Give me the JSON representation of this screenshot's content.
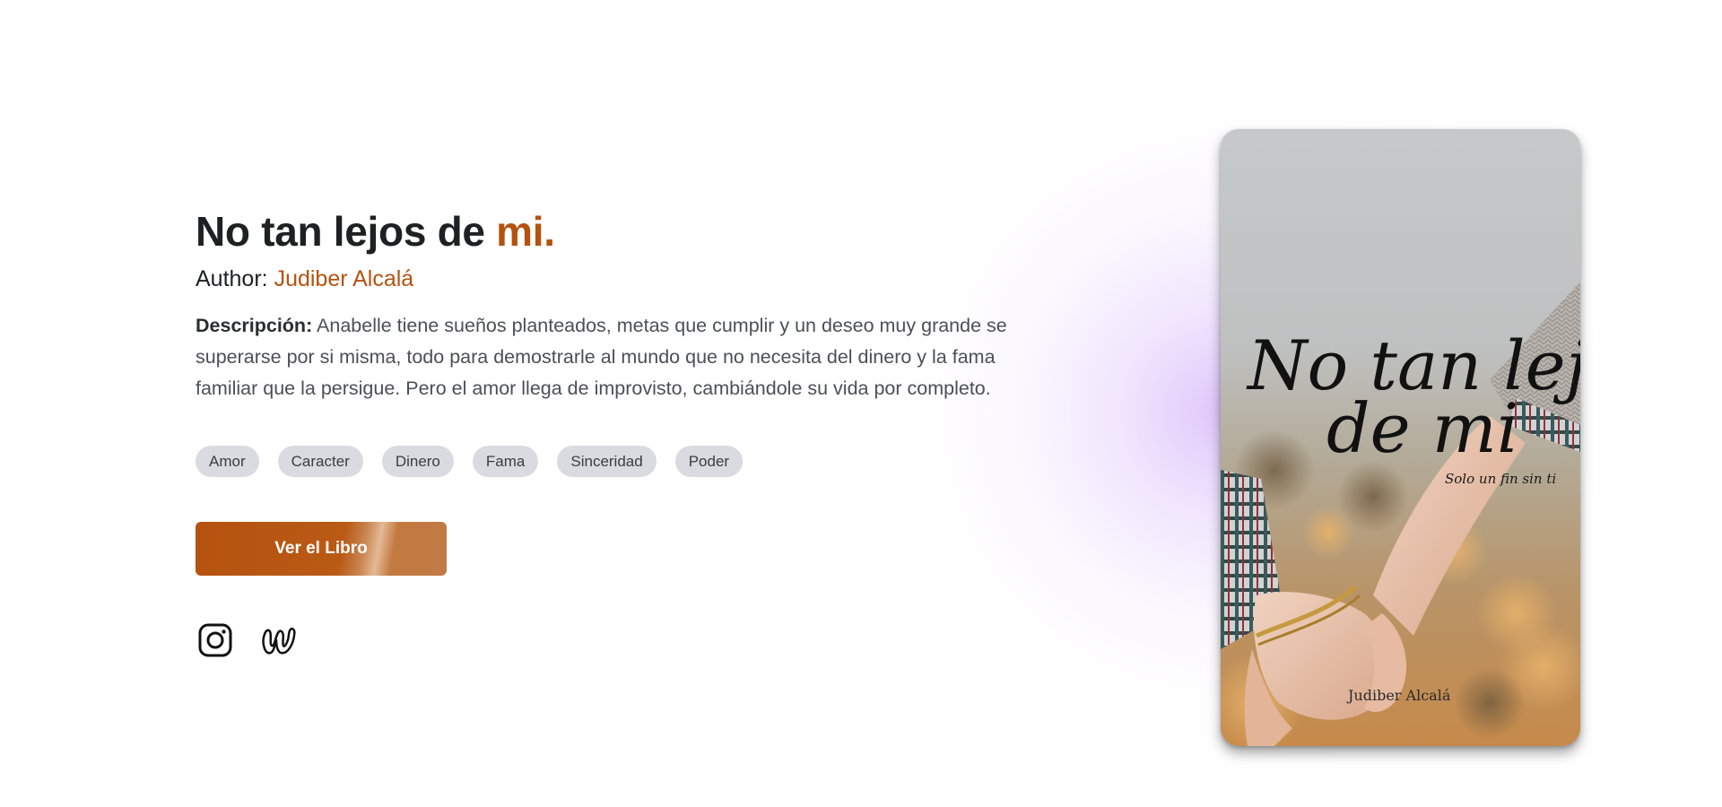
{
  "book": {
    "title_main": "No tan lejos de ",
    "title_accent": "mi.",
    "author_label": "Author:",
    "author_name": "Judiber Alcalá",
    "description_label": "Descripción:",
    "description_text": "Anabelle tiene sueños planteados, metas que cumplir y un deseo muy grande se superarse por si misma, todo para demostrarle al mundo que no necesita del dinero y la fama familiar que la persigue. Pero el amor llega de improvisto, cambiándole su vida por completo."
  },
  "tags": [
    "Amor",
    "Caracter",
    "Dinero",
    "Fama",
    "Sinceridad",
    "Poder"
  ],
  "cta": {
    "label": "Ver el Libro"
  },
  "socials": [
    {
      "name": "instagram-icon"
    },
    {
      "name": "wattpad-icon"
    }
  ],
  "cover": {
    "title_line1": "No tan lejos",
    "title_line2": "de mi",
    "subtitle": "Solo un fin sin ti",
    "author": "Judiber Alcalá"
  },
  "colors": {
    "accent": "#b5520f",
    "text_dark": "#1f2023",
    "text_body": "#4b4f57",
    "tag_bg": "#d9dbe0",
    "glow": "#dabefa"
  }
}
